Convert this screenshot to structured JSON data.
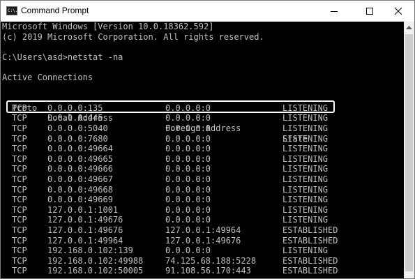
{
  "window": {
    "title": "Command Prompt",
    "icon_text": "C:\\."
  },
  "console": {
    "banner": [
      "Microsoft Windows [Version 10.0.18362.592]",
      "(c) 2019 Microsoft Corporation. All rights reserved."
    ],
    "prompt": "C:\\Users\\asd>netstat -na",
    "section_title": "Active Connections",
    "columns": [
      "Proto",
      "Local Address",
      "Foreign Address",
      "State"
    ],
    "rows": [
      [
        "TCP",
        "0.0.0.0:135",
        "0.0.0.0:0",
        "LISTENING"
      ],
      [
        "TCP",
        "0.0.0.0:445",
        "0.0.0.0:0",
        "LISTENING"
      ],
      [
        "TCP",
        "0.0.0.0:5040",
        "0.0.0.0:0",
        "LISTENING"
      ],
      [
        "TCP",
        "0.0.0.0:7680",
        "0.0.0.0:0",
        "LISTENING"
      ],
      [
        "TCP",
        "0.0.0.0:49664",
        "0.0.0.0:0",
        "LISTENING"
      ],
      [
        "TCP",
        "0.0.0.0:49665",
        "0.0.0.0:0",
        "LISTENING"
      ],
      [
        "TCP",
        "0.0.0.0:49666",
        "0.0.0.0:0",
        "LISTENING"
      ],
      [
        "TCP",
        "0.0.0.0:49667",
        "0.0.0.0:0",
        "LISTENING"
      ],
      [
        "TCP",
        "0.0.0.0:49668",
        "0.0.0.0:0",
        "LISTENING"
      ],
      [
        "TCP",
        "0.0.0.0:49669",
        "0.0.0.0:0",
        "LISTENING"
      ],
      [
        "TCP",
        "127.0.0.1:1001",
        "0.0.0.0:0",
        "LISTENING"
      ],
      [
        "TCP",
        "127.0.0.1:49676",
        "0.0.0.0:0",
        "LISTENING"
      ],
      [
        "TCP",
        "127.0.0.1:49676",
        "127.0.0.1:49964",
        "ESTABLISHED"
      ],
      [
        "TCP",
        "127.0.0.1:49964",
        "127.0.0.1:49676",
        "ESTABLISHED"
      ],
      [
        "TCP",
        "192.168.0.102:139",
        "0.0.0.0:0",
        "LISTENING"
      ],
      [
        "TCP",
        "192.168.0.102:49988",
        "74.125.68.188:5228",
        "ESTABLISHED"
      ],
      [
        "TCP",
        "192.168.0.102:50005",
        "91.108.56.170:443",
        "ESTABLISHED"
      ]
    ]
  },
  "icons": {
    "minimize": "minimize-icon",
    "maximize": "maximize-icon",
    "close": "close-icon",
    "scroll_up": "scroll-up-arrow-icon"
  },
  "colors": {
    "console_bg": "#000000",
    "console_text": "#c0c0c0",
    "highlight": "#ffffff"
  }
}
